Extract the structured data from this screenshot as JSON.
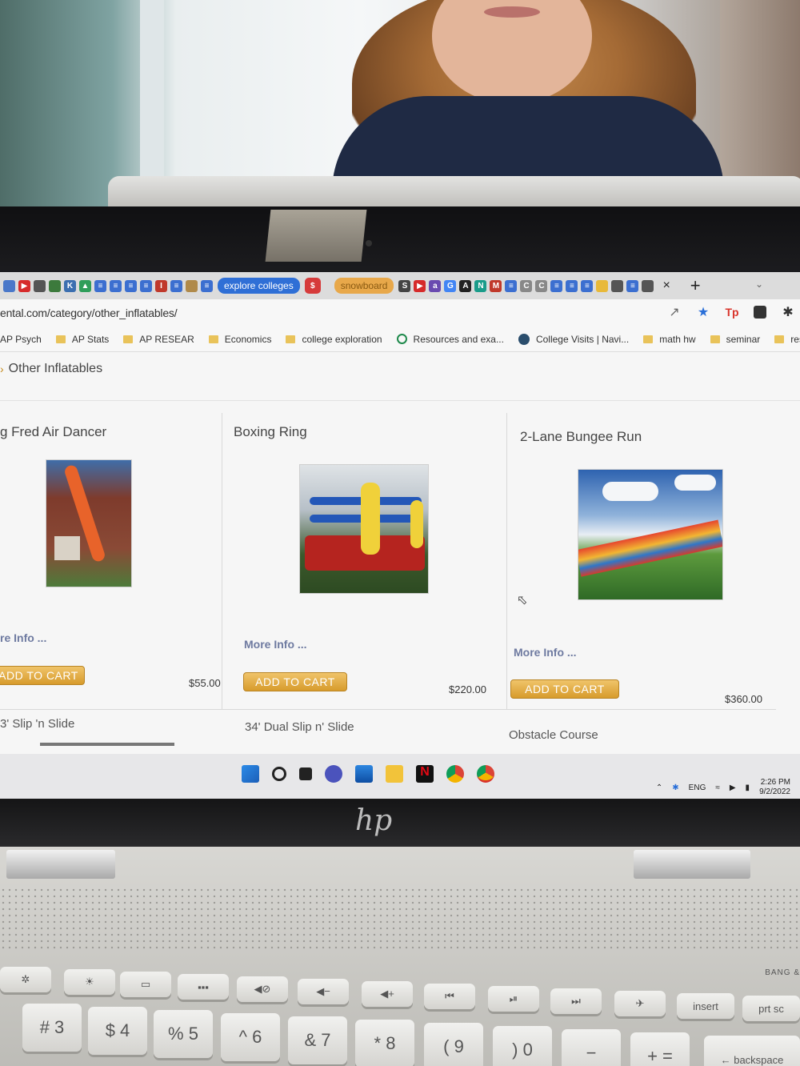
{
  "tabs": {
    "explore_label": "explore colleges",
    "snowboard_label": "snowboard",
    "dollar_label": "$",
    "close_glyph": "×",
    "new_tab_glyph": "+",
    "favicons_left": [
      {
        "icon": "doc-icon",
        "color": "#4a78c9",
        "glyph": ""
      },
      {
        "icon": "youtube-icon",
        "color": "#d62b2b",
        "glyph": "▶"
      },
      {
        "icon": "shield-icon",
        "color": "#555555",
        "glyph": ""
      },
      {
        "icon": "shield-icon",
        "color": "#3c7a3c",
        "glyph": ""
      },
      {
        "icon": "k-icon",
        "color": "#3b6fb0",
        "glyph": "K"
      },
      {
        "icon": "drive-icon",
        "color": "#2f9e5a",
        "glyph": "▲"
      },
      {
        "icon": "docs-icon",
        "color": "#3c6fd0",
        "glyph": "≡"
      },
      {
        "icon": "docs-icon",
        "color": "#3c6fd0",
        "glyph": "≡"
      },
      {
        "icon": "docs-icon",
        "color": "#3c6fd0",
        "glyph": "≡"
      },
      {
        "icon": "docs-icon",
        "color": "#3c6fd0",
        "glyph": "≡"
      },
      {
        "icon": "i-icon",
        "color": "#c0392b",
        "glyph": "I"
      },
      {
        "icon": "docs-icon",
        "color": "#3c6fd0",
        "glyph": "≡"
      },
      {
        "icon": "docs-icon",
        "color": "#b08a4a",
        "glyph": ""
      },
      {
        "icon": "docs-icon",
        "color": "#3c6fd0",
        "glyph": "≡"
      }
    ],
    "favicons_right": [
      {
        "icon": "s-icon",
        "color": "#444444",
        "glyph": "S"
      },
      {
        "icon": "youtube-icon",
        "color": "#d62b2b",
        "glyph": "▶"
      },
      {
        "icon": "a-icon",
        "color": "#6a4ab0",
        "glyph": "a"
      },
      {
        "icon": "google-icon",
        "color": "#4285f4",
        "glyph": "G"
      },
      {
        "icon": "a-icon",
        "color": "#222222",
        "glyph": "A"
      },
      {
        "icon": "n-icon",
        "color": "#1a9c8a",
        "glyph": "N"
      },
      {
        "icon": "gmail-icon",
        "color": "#c0392b",
        "glyph": "M"
      },
      {
        "icon": "docs-icon",
        "color": "#3c6fd0",
        "glyph": "≡"
      },
      {
        "icon": "c-icon",
        "color": "#888888",
        "glyph": "C"
      },
      {
        "icon": "c-icon",
        "color": "#888888",
        "glyph": "C"
      },
      {
        "icon": "docs-icon",
        "color": "#3c6fd0",
        "glyph": "≡"
      },
      {
        "icon": "docs-icon",
        "color": "#3c6fd0",
        "glyph": "≡"
      },
      {
        "icon": "docs-icon",
        "color": "#3c6fd0",
        "glyph": "≡"
      },
      {
        "icon": "docs-icon",
        "color": "#e8b93a",
        "glyph": ""
      },
      {
        "icon": "globe-icon",
        "color": "#555555",
        "glyph": ""
      },
      {
        "icon": "docs-icon",
        "color": "#3c6fd0",
        "glyph": "≡"
      },
      {
        "icon": "globe-icon",
        "color": "#555555",
        "glyph": ""
      }
    ]
  },
  "address": {
    "url": "ental.com/category/other_inflatables/"
  },
  "bookmarks": [
    {
      "label": "AP Psych",
      "icon": "folder-icon"
    },
    {
      "label": "AP Stats",
      "icon": "folder-icon"
    },
    {
      "label": "AP RESEAR",
      "icon": "folder-icon"
    },
    {
      "label": "Economics",
      "icon": "folder-icon"
    },
    {
      "label": "college exploration",
      "icon": "folder-icon"
    },
    {
      "label": "Resources and exa...",
      "icon": "check-icon"
    },
    {
      "label": "College Visits | Navi...",
      "icon": "globe-icon"
    },
    {
      "label": "math hw",
      "icon": "folder-icon"
    },
    {
      "label": "seminar",
      "icon": "folder-icon"
    },
    {
      "label": "restaurant",
      "icon": "folder-icon"
    }
  ],
  "page": {
    "breadcrumb_arrow": "›",
    "category_title": "Other Inflatables",
    "products": [
      {
        "title": "g Fred Air Dancer",
        "more_info": "re Info ...",
        "cart": "ADD TO CART",
        "price": "$55.00"
      },
      {
        "title": "Boxing Ring",
        "more_info": "More Info ...",
        "cart": "ADD TO CART",
        "price": "$220.00"
      },
      {
        "title": "2-Lane Bungee Run",
        "more_info": "More Info ...",
        "cart": "ADD TO CART",
        "price": "$360.00"
      }
    ],
    "next_row": [
      "3' Slip 'n Slide",
      "34' Dual Slip n' Slide",
      "Obstacle Course"
    ]
  },
  "taskbar": {
    "language": "ENG",
    "time": "2:26 PM",
    "date": "9/2/2022"
  },
  "laptop": {
    "brand_mark": "hp",
    "audio_label": "BANG &",
    "function_keys": [
      "✲",
      "☀",
      "▭",
      "▪▪▪",
      "◀⊘",
      "◀−",
      "◀+",
      "⏮",
      "⏯",
      "⏭",
      "✈",
      "insert",
      "prt sc"
    ],
    "number_keys": [
      "# 3",
      "$ 4",
      "% 5",
      "^ 6",
      "& 7",
      "* 8",
      "( 9",
      ") 0",
      "−",
      "+ =",
      "← backspace"
    ]
  }
}
